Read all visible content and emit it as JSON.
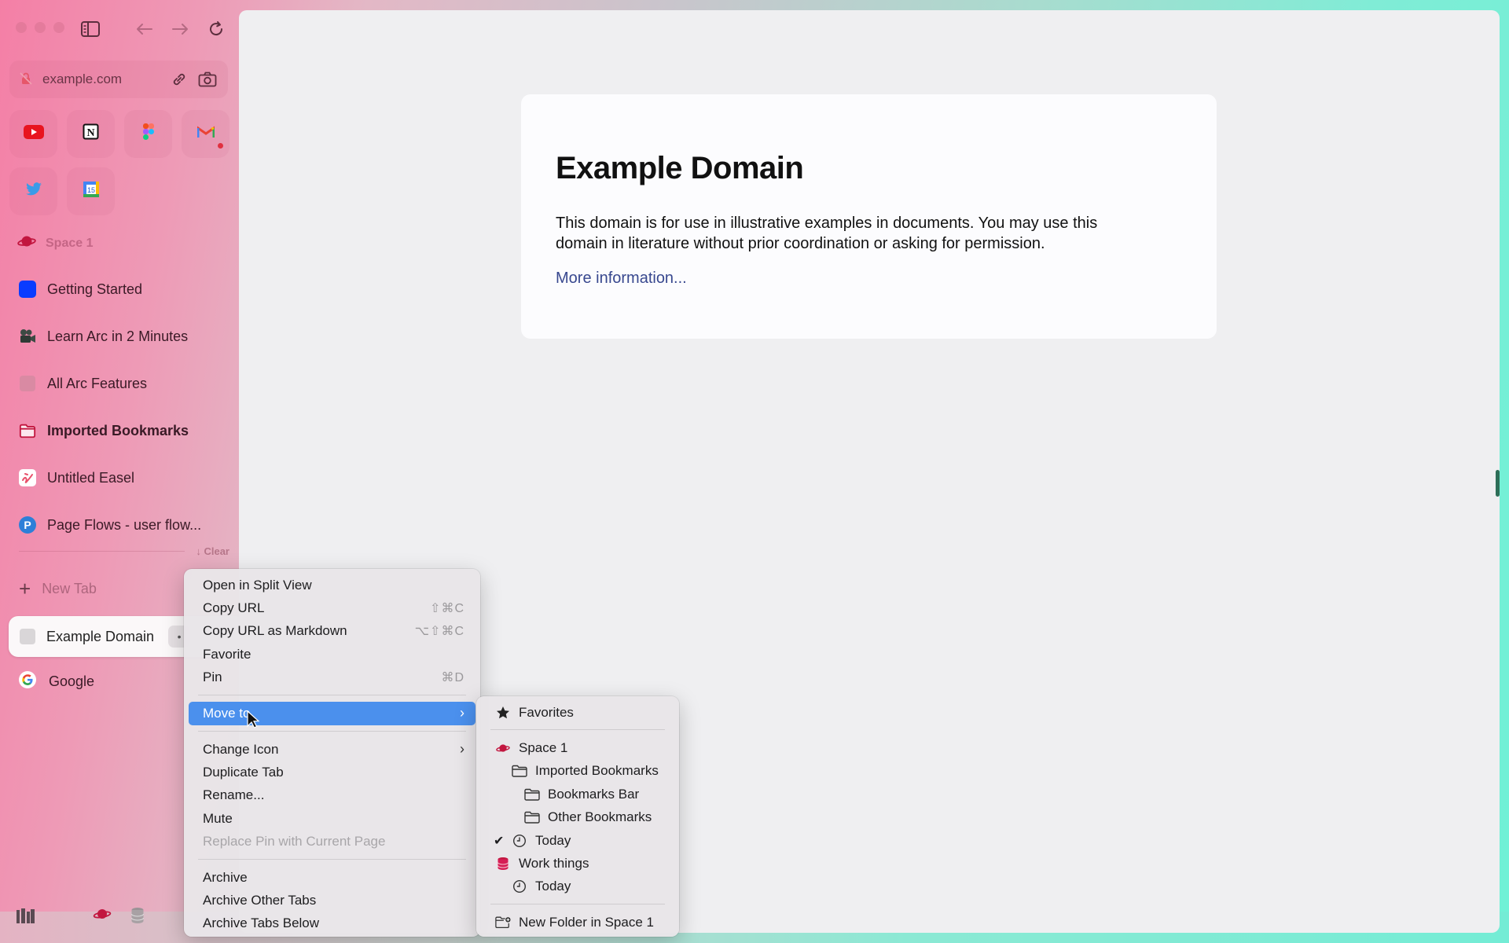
{
  "window": {
    "frame_gradient": [
      "#f47fa6",
      "#c9c5cc",
      "#6ff1d6"
    ]
  },
  "sidebar": {
    "toolbar": {
      "traffic_lights": [
        "close",
        "minimize",
        "zoom"
      ],
      "icons": [
        "sidebar-toggle-icon",
        "back-arrow-icon",
        "forward-arrow-icon",
        "reload-icon"
      ]
    },
    "url_bar": {
      "url": "example.com",
      "site_icon": "insecure-lock-icon",
      "actions": [
        "link-icon",
        "camera-icon"
      ]
    },
    "favorites": [
      {
        "name": "YouTube",
        "icon": "youtube-icon",
        "badge": false
      },
      {
        "name": "Notion",
        "icon": "notion-icon",
        "badge": false
      },
      {
        "name": "Figma",
        "icon": "figma-icon",
        "badge": false
      },
      {
        "name": "Gmail",
        "icon": "gmail-icon",
        "badge": true
      },
      {
        "name": "Twitter",
        "icon": "twitter-icon",
        "badge": false
      },
      {
        "name": "Google Calendar",
        "icon": "calendar-icon",
        "badge": false,
        "calendar_day": "15"
      }
    ],
    "space": {
      "name": "Space 1",
      "icon": "planet-icon",
      "color": "#c2163f"
    },
    "pinned_tabs": [
      {
        "label": "Getting Started",
        "icon": "blue-square-icon",
        "bold": false
      },
      {
        "label": "Learn Arc in 2 Minutes",
        "icon": "video-camera-icon",
        "bold": false
      },
      {
        "label": "All Arc Features",
        "icon": "pink-square-icon",
        "bold": false
      },
      {
        "label": "Imported Bookmarks",
        "icon": "folder-icon",
        "bold": true
      },
      {
        "label": "Untitled Easel",
        "icon": "easel-icon",
        "bold": false
      },
      {
        "label": "Page Flows - user flow...",
        "icon": "pageflows-icon",
        "bold": false
      }
    ],
    "clear_label": "Clear",
    "new_tab_label": "New Tab",
    "today_tabs": [
      {
        "label": "Example Domain",
        "active": true
      },
      {
        "label": "Google",
        "active": false
      }
    ],
    "bottom_icons": [
      "library-icon",
      "planet-icon",
      "database-icon"
    ]
  },
  "page": {
    "title": "Example Domain",
    "body": "This domain is for use in illustrative examples in documents. You may use this domain in literature without prior coordination or asking for permission.",
    "link": "More information..."
  },
  "context_menu": {
    "items": [
      {
        "label": "Open in Split View",
        "shortcut": ""
      },
      {
        "label": "Copy URL",
        "shortcut": "⇧⌘C"
      },
      {
        "label": "Copy URL as Markdown",
        "shortcut": "⌥⇧⌘C"
      },
      {
        "label": "Favorite",
        "shortcut": ""
      },
      {
        "label": "Pin",
        "shortcut": "⌘D"
      },
      {
        "label": "Move to",
        "submenu": true,
        "highlighted": true
      },
      {
        "label": "Change Icon",
        "submenu": true
      },
      {
        "label": "Duplicate Tab"
      },
      {
        "label": "Rename..."
      },
      {
        "label": "Mute"
      },
      {
        "label": "Replace Pin with Current Page",
        "disabled": true
      },
      {
        "label": "Archive"
      },
      {
        "label": "Archive Other Tabs"
      },
      {
        "label": "Archive Tabs Below"
      }
    ],
    "highlight_color": "#4b90ed"
  },
  "move_to_submenu": {
    "items": [
      {
        "label": "Favorites",
        "icon": "star-icon",
        "indent": 0
      },
      {
        "label": "Space 1",
        "icon": "planet-icon",
        "indent": 0
      },
      {
        "label": "Imported Bookmarks",
        "icon": "folder-icon",
        "indent": 1
      },
      {
        "label": "Bookmarks Bar",
        "icon": "folder-icon",
        "indent": 2
      },
      {
        "label": "Other Bookmarks",
        "icon": "folder-icon",
        "indent": 2
      },
      {
        "label": "Today",
        "icon": "clock-icon",
        "indent": 1,
        "checked": true
      },
      {
        "label": "Work things",
        "icon": "database-icon",
        "indent": 0
      },
      {
        "label": "Today",
        "icon": "clock-icon",
        "indent": 1
      },
      {
        "label": "New Folder in Space 1",
        "icon": "new-folder-icon",
        "indent": 0
      }
    ]
  }
}
